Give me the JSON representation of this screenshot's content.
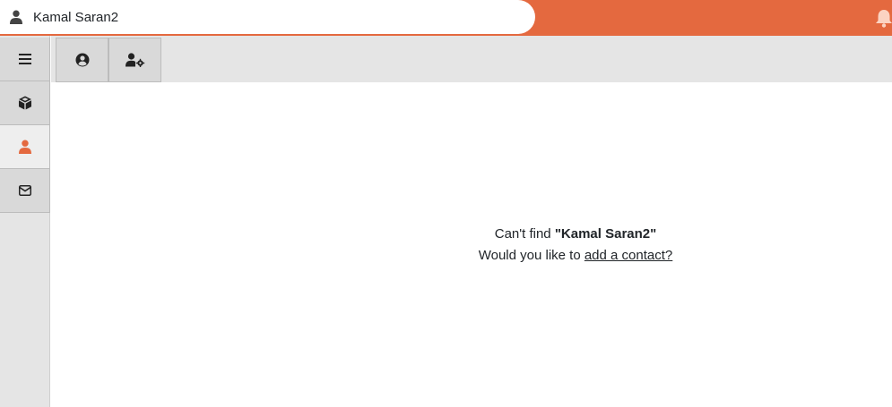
{
  "search": {
    "value": "Kamal Saran2",
    "icon": "user-icon"
  },
  "topbar": {
    "bell_icon": "bell-icon",
    "accent": "#e4693f"
  },
  "sidebar": {
    "items": [
      {
        "name": "menu",
        "icon": "hamburger-icon"
      },
      {
        "name": "products",
        "icon": "box-icon"
      },
      {
        "name": "contacts",
        "icon": "user-icon",
        "active": true,
        "color": "#e4693f"
      },
      {
        "name": "messages",
        "icon": "envelope-icon"
      }
    ]
  },
  "tabs": [
    {
      "name": "profile",
      "icon": "user-circle-icon"
    },
    {
      "name": "user-settings",
      "icon": "user-cog-icon"
    }
  ],
  "empty_state": {
    "line1_prefix": "Can't find",
    "query": "\"Kamal Saran2\"",
    "line2_prefix": "Would you like to",
    "link": "add a contact?"
  }
}
